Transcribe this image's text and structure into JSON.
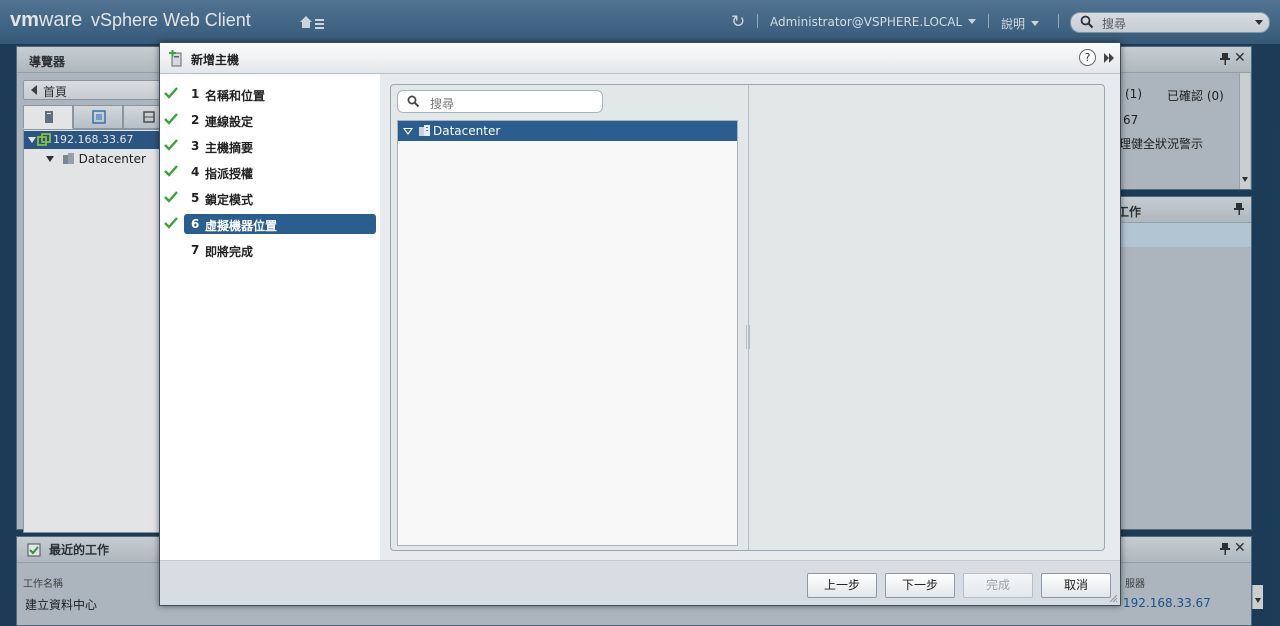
{
  "header": {
    "brand_vm": "vm",
    "brand_ware": "ware",
    "brand_product": "vSphere Web Client",
    "user": "Administrator@VSPHERE.LOCAL",
    "help": "說明",
    "search_placeholder": "搜尋"
  },
  "navigator": {
    "title": "導覽器",
    "breadcrumb": "首頁",
    "tree": [
      {
        "label": "192.168.33.67"
      },
      {
        "label": "Datacenter"
      }
    ]
  },
  "right_panel": {
    "tab_partial": "(1)",
    "acknowledged": "已確認 (0)",
    "line1": "67",
    "line2": "理健全狀況警示",
    "section2_title": "工作"
  },
  "recent_tasks": {
    "title": "最近的工作",
    "col_task_name": "工作名稱",
    "col_server": "服器",
    "row_task_name": "建立資料中心",
    "row_server": "192.168.33.67"
  },
  "dialog": {
    "title": "新增主機",
    "help": "?",
    "steps": [
      {
        "num": "1",
        "label": "名稱和位置",
        "done": true,
        "active": false
      },
      {
        "num": "2",
        "label": "連線設定",
        "done": true,
        "active": false
      },
      {
        "num": "3",
        "label": "主機摘要",
        "done": true,
        "active": false
      },
      {
        "num": "4",
        "label": "指派授權",
        "done": true,
        "active": false
      },
      {
        "num": "5",
        "label": "鎖定模式",
        "done": true,
        "active": false
      },
      {
        "num": "6",
        "label": "虛擬機器位置",
        "done": true,
        "active": true
      },
      {
        "num": "7",
        "label": "即將完成",
        "done": false,
        "active": false
      }
    ],
    "search_placeholder": "搜尋",
    "tree_item": "Datacenter",
    "buttons": {
      "back": "上一步",
      "next": "下一步",
      "finish": "完成",
      "cancel": "取消"
    }
  },
  "colors": {
    "accent": "#2b5d8f",
    "check": "#3aa23a"
  }
}
